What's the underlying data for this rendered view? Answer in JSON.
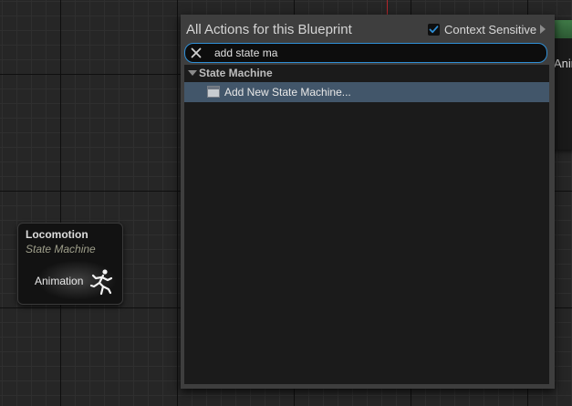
{
  "menu": {
    "title": "All Actions for this Blueprint",
    "context_sensitive": {
      "label": "Context Sensitive",
      "checked": true
    },
    "search": {
      "value": "add state ma"
    },
    "categories": [
      {
        "label": "State Machine",
        "items": [
          {
            "label": "Add New State Machine...",
            "selected": true
          }
        ]
      }
    ]
  },
  "graph_node": {
    "title": "Locomotion",
    "subtitle": "State Machine",
    "pose_label": "Animation"
  },
  "background_node": {
    "label_fragment": "Anin"
  },
  "icons": {
    "clear": "close-icon",
    "checkbox": "checkmark-icon",
    "expand": "chevron-right-icon",
    "category": "triangle-down-icon",
    "item": "state-machine-icon",
    "pose": "running-figure-icon"
  },
  "colors": {
    "graph_bg": "#262626",
    "menu_bg": "#3e3e3e",
    "results_bg": "#1b1b1b",
    "selection": "#42566a",
    "search_border": "#2f8fd6",
    "checkbox_accent": "#2f8fd6",
    "node_header": "#3f7a47"
  }
}
